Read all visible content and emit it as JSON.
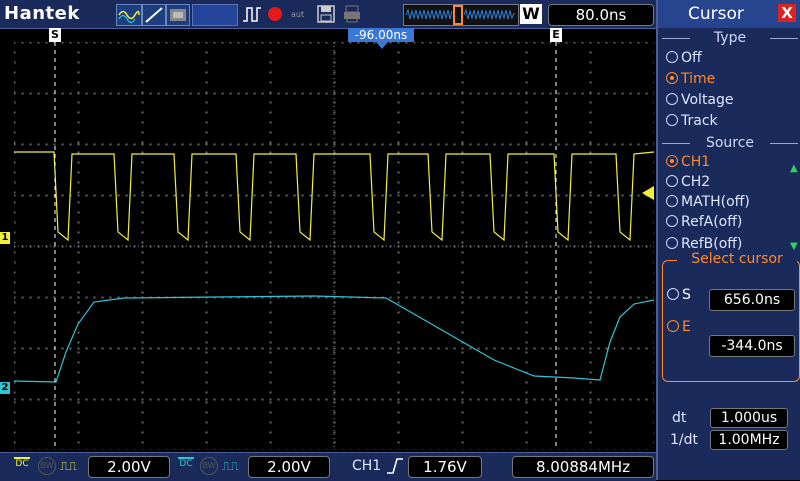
{
  "brand": "Hantek",
  "top": {
    "timebase": "80.0ns",
    "window_badge": "W"
  },
  "cursors": {
    "s_marker": "S",
    "e_marker": "E",
    "trigger_position": "-96.00ns"
  },
  "channels": {
    "ch1_marker": "1",
    "ch2_marker": "2",
    "ch1_color": "#f5ef3a",
    "ch2_color": "#2ec6d6"
  },
  "panel": {
    "title": "Cursor",
    "close": "X",
    "type_header": "Type",
    "type_options": [
      "Off",
      "Time",
      "Voltage",
      "Track"
    ],
    "type_selected": "Time",
    "source_header": "Source",
    "source_options": [
      "CH1",
      "CH2",
      "MATH(off)",
      "RefA(off)",
      "RefB(off)"
    ],
    "source_selected": "CH1",
    "select_header": "Select cursor",
    "s_label": "S",
    "s_value": "656.0ns",
    "e_label": "E",
    "e_value": "-344.0ns",
    "dt_label": "dt",
    "dt_value": "1.000us",
    "inv_dt_label": "1/dt",
    "inv_dt_value": "1.00MHz"
  },
  "bottom": {
    "ch1_coupling": "DC",
    "ch1_scale": "2.00V",
    "ch2_coupling": "DC",
    "ch2_scale": "2.00V",
    "trigger_source": "CH1",
    "trigger_level": "1.76V",
    "frequency": "8.00884MHz"
  }
}
